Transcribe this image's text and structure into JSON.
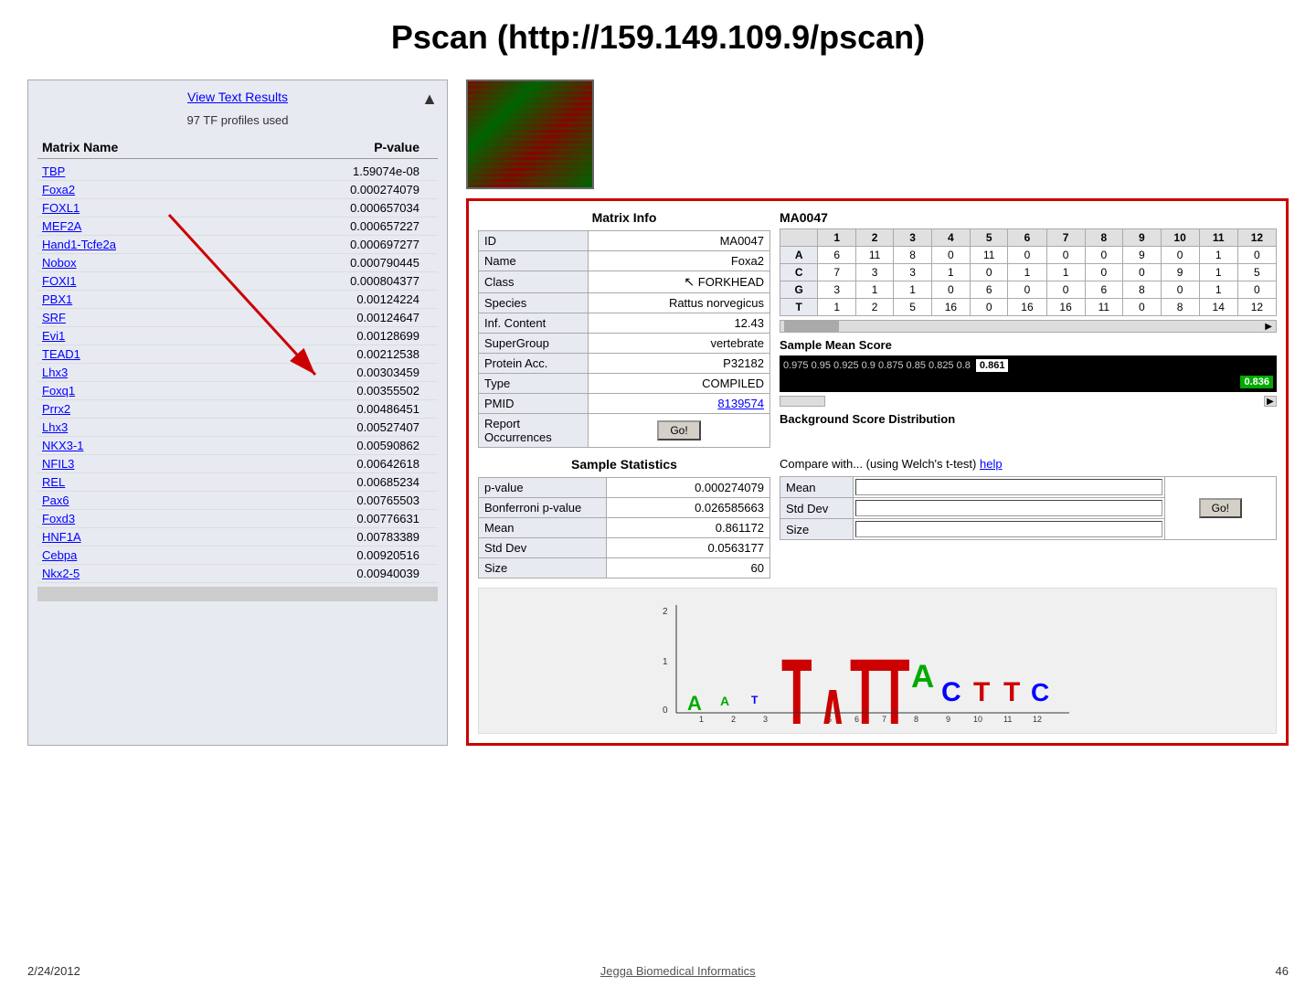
{
  "title": "Pscan (http://159.149.109.9/pscan)",
  "left_panel": {
    "view_text_link": "View Text Results",
    "tf_profiles": "97 TF profiles used",
    "col_matrix": "Matrix Name",
    "col_pvalue": "P-value",
    "rows": [
      {
        "matrix": "TBP",
        "pvalue": "1.59074e-08"
      },
      {
        "matrix": "Foxa2",
        "pvalue": "0.000274079"
      },
      {
        "matrix": "FOXL1",
        "pvalue": "0.000657034"
      },
      {
        "matrix": "MEF2A",
        "pvalue": "0.000657227"
      },
      {
        "matrix": "Hand1-Tcfe2a",
        "pvalue": "0.000697277"
      },
      {
        "matrix": "Nobox",
        "pvalue": "0.000790445"
      },
      {
        "matrix": "FOXI1",
        "pvalue": "0.000804377"
      },
      {
        "matrix": "PBX1",
        "pvalue": "0.00124224"
      },
      {
        "matrix": "SRF",
        "pvalue": "0.00124647"
      },
      {
        "matrix": "Evi1",
        "pvalue": "0.00128699"
      },
      {
        "matrix": "TEAD1",
        "pvalue": "0.00212538"
      },
      {
        "matrix": "Lhx3",
        "pvalue": "0.00303459"
      },
      {
        "matrix": "Foxq1",
        "pvalue": "0.00355502"
      },
      {
        "matrix": "Prrx2",
        "pvalue": "0.00486451"
      },
      {
        "matrix": "Lhx3",
        "pvalue": "0.00527407"
      },
      {
        "matrix": "NKX3-1",
        "pvalue": "0.00590862"
      },
      {
        "matrix": "NFIL3",
        "pvalue": "0.00642618"
      },
      {
        "matrix": "REL",
        "pvalue": "0.00685234"
      },
      {
        "matrix": "Pax6",
        "pvalue": "0.00765503"
      },
      {
        "matrix": "Foxd3",
        "pvalue": "0.00776631"
      },
      {
        "matrix": "HNF1A",
        "pvalue": "0.00783389"
      },
      {
        "matrix": "Cebpa",
        "pvalue": "0.00920516"
      },
      {
        "matrix": "Nkx2-5",
        "pvalue": "0.00940039"
      }
    ]
  },
  "matrix_info": {
    "title": "Matrix Info",
    "fields": [
      {
        "label": "ID",
        "value": "MA0047"
      },
      {
        "label": "Name",
        "value": "Foxa2"
      },
      {
        "label": "Class",
        "value": "FORKHEAD"
      },
      {
        "label": "Species",
        "value": "Rattus norvegicus"
      },
      {
        "label": "Inf. Content",
        "value": "12.43"
      },
      {
        "label": "SuperGroup",
        "value": "vertebrate"
      },
      {
        "label": "Protein Acc.",
        "value": "P32182"
      },
      {
        "label": "Type",
        "value": "COMPILED"
      },
      {
        "label": "PMID",
        "value": "8139574"
      },
      {
        "label": "Report Occurrences",
        "value": "Go!"
      }
    ]
  },
  "ma0047": {
    "title": "MA0047",
    "col_headers": [
      "",
      "1",
      "2",
      "3",
      "4",
      "5",
      "6",
      "7",
      "8",
      "9",
      "10",
      "11",
      "12"
    ],
    "rows": [
      {
        "label": "A",
        "values": [
          "6",
          "11",
          "8",
          "0",
          "11",
          "0",
          "0",
          "0",
          "9",
          "0",
          "1",
          "0"
        ]
      },
      {
        "label": "C",
        "values": [
          "7",
          "3",
          "3",
          "1",
          "0",
          "1",
          "1",
          "0",
          "0",
          "9",
          "1",
          "5"
        ]
      },
      {
        "label": "G",
        "values": [
          "3",
          "1",
          "1",
          "0",
          "6",
          "0",
          "0",
          "6",
          "8",
          "0",
          "1",
          "0"
        ]
      },
      {
        "label": "T",
        "values": [
          "1",
          "2",
          "5",
          "16",
          "0",
          "16",
          "16",
          "11",
          "0",
          "8",
          "14",
          "12"
        ]
      }
    ]
  },
  "sample_mean": {
    "title": "Sample Mean Score",
    "score_highlight": "0.861",
    "score_values": [
      "0.975",
      "0.95",
      "0.925",
      "0.9",
      "0.875",
      "0.85",
      "0.825",
      "0.8"
    ],
    "score_green": "0.836"
  },
  "background_score": {
    "title": "Background Score Distribution"
  },
  "sample_stats": {
    "title": "Sample Statistics",
    "rows": [
      {
        "label": "p-value",
        "value": "0.000274079"
      },
      {
        "label": "Bonferroni p-value",
        "value": "0.026585663"
      },
      {
        "label": "Mean",
        "value": "0.861172"
      },
      {
        "label": "Std Dev",
        "value": "0.0563177"
      },
      {
        "label": "Size",
        "value": "60"
      }
    ]
  },
  "compare": {
    "title_prefix": "Compare with... (using Welch's t-test)",
    "help_link": "help",
    "rows": [
      {
        "label": "Mean"
      },
      {
        "label": "Std Dev"
      },
      {
        "label": "Size"
      }
    ],
    "go_button": "Go!"
  },
  "footer": {
    "date": "2/24/2012",
    "center": "Jegga Biomedical Informatics",
    "page": "46"
  }
}
